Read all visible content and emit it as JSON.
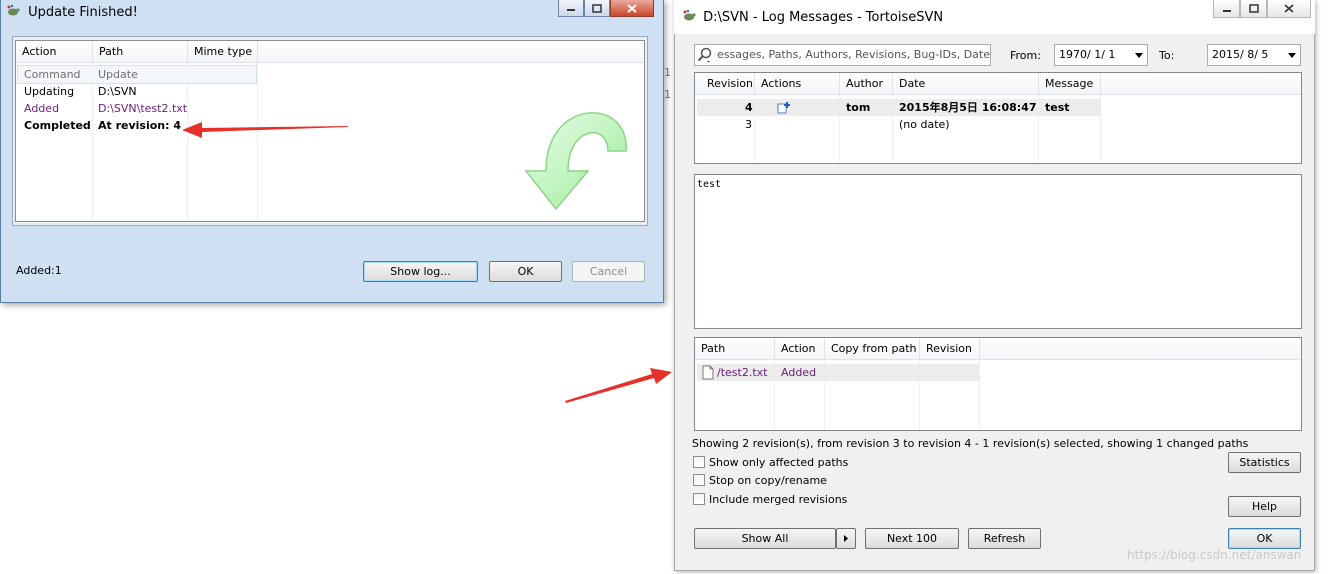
{
  "update_window": {
    "title": "Update Finished!",
    "columns": [
      "Action",
      "Path",
      "Mime type"
    ],
    "rows": [
      {
        "action": "Command",
        "path": "Update",
        "style": "cmd"
      },
      {
        "action": "Updating",
        "path": "D:\\SVN",
        "style": "normal"
      },
      {
        "action": "Added",
        "path": "D:\\SVN\\test2.txt",
        "style": "added"
      },
      {
        "action": "Completed",
        "path": "At revision: 4",
        "style": "completed"
      }
    ],
    "status": "Added:1",
    "show_log_label": "Show log...",
    "ok_label": "OK",
    "cancel_label": "Cancel"
  },
  "log_window": {
    "title": "D:\\SVN - Log Messages - TortoiseSVN",
    "search_placeholder": "essages, Paths, Authors, Revisions, Bug-IDs, Date,",
    "from_label": "From:",
    "from_value": "1970/  1/  1",
    "to_label": "To:",
    "to_value": "2015/  8/  5",
    "revisions": {
      "columns": [
        "Revision",
        "Actions",
        "Author",
        "Date",
        "Message"
      ],
      "rows": [
        {
          "revision": "4",
          "author": "tom",
          "date": "2015年8月5日 16:08:47",
          "message": "test",
          "bold": true
        },
        {
          "revision": "3",
          "author": "",
          "date": "(no date)",
          "message": "",
          "bold": false
        }
      ]
    },
    "message_text": "test",
    "paths": {
      "columns": [
        "Path",
        "Action",
        "Copy from path",
        "Revision"
      ],
      "rows": [
        {
          "path": "/test2.txt",
          "action": "Added",
          "copy_from": "",
          "revision": ""
        }
      ]
    },
    "summary": "Showing 2 revision(s), from revision 3 to revision 4 - 1 revision(s) selected, showing 1 changed paths",
    "checkboxes": [
      "Show only affected paths",
      "Stop on copy/rename",
      "Include merged revisions"
    ],
    "statistics_label": "Statistics",
    "help_label": "Help",
    "show_all_label": "Show All",
    "next100_label": "Next 100",
    "refresh_label": "Refresh",
    "ok_label": "OK"
  },
  "watermark": "https://blog.csdn.net/answan",
  "colors": {
    "added_text": "#6b1c7a",
    "arrow": "#e8302a",
    "green_arrow": "#7fe07a"
  }
}
